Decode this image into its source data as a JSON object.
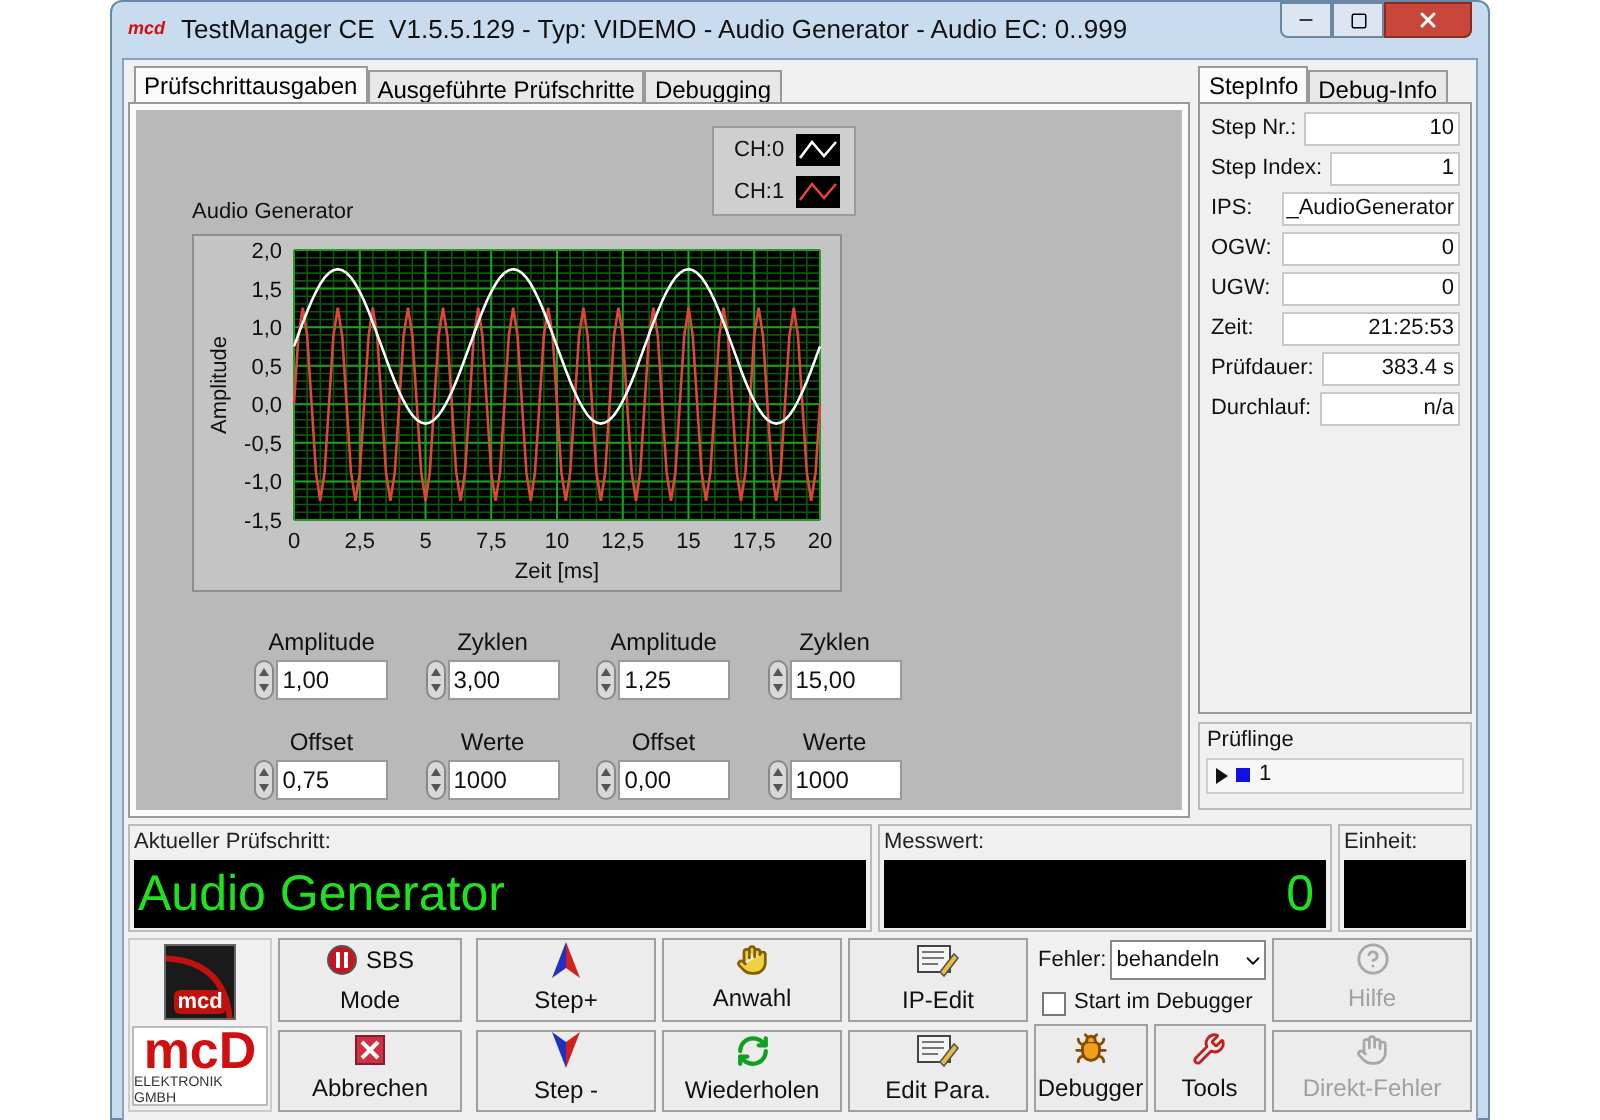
{
  "window": {
    "title": "TestManager CE  V1.5.5.129 - Typ: VIDEMO - Audio Generator - Audio EC: 0..999",
    "icon_text": "mcd"
  },
  "tabs": [
    {
      "label": "Prüfschrittausgaben",
      "selected": true
    },
    {
      "label": "Ausgeführte Prüfschritte",
      "selected": false
    },
    {
      "label": "Debugging",
      "selected": false
    }
  ],
  "graph": {
    "chart_data": {
      "type": "line",
      "grid": true,
      "title": "Audio Generator",
      "xlabel": "Zeit [ms]",
      "ylabel": "Amplitude",
      "xlim": [
        0,
        20
      ],
      "ylim": [
        -1.5,
        2
      ],
      "xticks": [
        0,
        {
          "value": 2.5,
          "label": "2,5"
        },
        5,
        {
          "value": 7.5,
          "label": "7,5"
        },
        10,
        {
          "value": 12.5,
          "label": "12,5"
        },
        15,
        {
          "value": 17.5,
          "label": "17,5"
        },
        20
      ],
      "yticks": [
        {
          "value": 2,
          "label": "2,0"
        },
        {
          "value": 1.5,
          "label": "1,5"
        },
        {
          "value": 1,
          "label": "1,0"
        },
        {
          "value": 0.5,
          "label": "0,5"
        },
        {
          "value": 0,
          "label": "0,0"
        },
        {
          "value": -0.5,
          "label": "-0,5"
        },
        {
          "value": -1,
          "label": "-1,0"
        },
        {
          "value": -1.5,
          "label": "-1,5"
        }
      ],
      "x": [
        0,
        0.167,
        0.333,
        0.5,
        0.667,
        0.833,
        1,
        1.167,
        1.333,
        1.5,
        1.667,
        1.833,
        2,
        2.167,
        2.333,
        2.5,
        2.667,
        2.833,
        3,
        3.167,
        3.333,
        3.5,
        3.667,
        3.833,
        4,
        4.167,
        4.333,
        4.5,
        4.667,
        4.833,
        5,
        5.167,
        5.333,
        5.5,
        5.667,
        5.833,
        6,
        6.167,
        6.333,
        6.5,
        6.667,
        6.833,
        7,
        7.167,
        7.333,
        7.5,
        7.667,
        7.833,
        8,
        8.167,
        8.333,
        8.5,
        8.667,
        8.833,
        9,
        9.167,
        9.333,
        9.5,
        9.667,
        9.833,
        10,
        10.167,
        10.333,
        10.5,
        10.667,
        10.833,
        11,
        11.167,
        11.333,
        11.5,
        11.667,
        11.833,
        12,
        12.167,
        12.333,
        12.5,
        12.667,
        12.833,
        13,
        13.167,
        13.333,
        13.5,
        13.667,
        13.833,
        14,
        14.167,
        14.333,
        14.5,
        14.667,
        14.833,
        15,
        15.167,
        15.333,
        15.5,
        15.667,
        15.833,
        16,
        16.167,
        16.333,
        16.5,
        16.667,
        16.833,
        17,
        17.167,
        17.333,
        17.5,
        17.667,
        17.833,
        18,
        18.167,
        18.333,
        18.5,
        18.667,
        18.833,
        19,
        19.167,
        19.333,
        19.5,
        19.667,
        19.833,
        20
      ],
      "series": [
        {
          "name": "CH:0",
          "color": "#ffffff",
          "values": [
            0.75,
            0.906,
            1.059,
            1.204,
            1.338,
            1.457,
            1.559,
            1.641,
            1.701,
            1.738,
            1.75,
            1.738,
            1.701,
            1.641,
            1.559,
            1.457,
            1.338,
            1.204,
            1.059,
            0.906,
            0.75,
            0.594,
            0.441,
            0.296,
            0.162,
            0.043,
            -0.059,
            -0.141,
            -0.201,
            -0.238,
            -0.25,
            -0.238,
            -0.201,
            -0.141,
            -0.059,
            0.043,
            0.162,
            0.296,
            0.441,
            0.594,
            0.75,
            0.906,
            1.059,
            1.204,
            1.338,
            1.457,
            1.559,
            1.641,
            1.701,
            1.738,
            1.75,
            1.738,
            1.701,
            1.641,
            1.559,
            1.457,
            1.338,
            1.204,
            1.059,
            0.906,
            0.75,
            0.594,
            0.441,
            0.296,
            0.162,
            0.043,
            -0.059,
            -0.141,
            -0.201,
            -0.238,
            -0.25,
            -0.238,
            -0.201,
            -0.141,
            -0.059,
            0.043,
            0.162,
            0.296,
            0.441,
            0.594,
            0.75,
            0.906,
            1.059,
            1.204,
            1.338,
            1.457,
            1.559,
            1.641,
            1.701,
            1.738,
            1.75,
            1.738,
            1.701,
            1.641,
            1.559,
            1.457,
            1.338,
            1.204,
            1.059,
            0.906,
            0.75,
            0.594,
            0.441,
            0.296,
            0.162,
            0.043,
            -0.059,
            -0.141,
            -0.201,
            -0.238,
            -0.25,
            -0.238,
            -0.201,
            -0.141,
            -0.059,
            0.043,
            0.162,
            0.296,
            0.441,
            0.594,
            0.75
          ]
        },
        {
          "name": "CH:1",
          "color": "#e0453a",
          "values": [
            0,
            0.884,
            1.25,
            0.884,
            0,
            -0.884,
            -1.25,
            -0.884,
            0,
            0.884,
            1.25,
            0.884,
            0,
            -0.884,
            -1.25,
            -0.884,
            0,
            0.884,
            1.25,
            0.884,
            0,
            -0.884,
            -1.25,
            -0.884,
            0,
            0.884,
            1.25,
            0.884,
            0,
            -0.884,
            -1.25,
            -0.884,
            0,
            0.884,
            1.25,
            0.884,
            0,
            -0.884,
            -1.25,
            -0.884,
            0,
            0.884,
            1.25,
            0.884,
            0,
            -0.884,
            -1.25,
            -0.884,
            0,
            0.884,
            1.25,
            0.884,
            0,
            -0.884,
            -1.25,
            -0.884,
            0,
            0.884,
            1.25,
            0.884,
            0,
            -0.884,
            -1.25,
            -0.884,
            0,
            0.884,
            1.25,
            0.884,
            0,
            -0.884,
            -1.25,
            -0.884,
            0,
            0.884,
            1.25,
            0.884,
            0,
            -0.884,
            -1.25,
            -0.884,
            0,
            0.884,
            1.25,
            0.884,
            0,
            -0.884,
            -1.25,
            -0.884,
            0,
            0.884,
            1.25,
            0.884,
            0,
            -0.884,
            -1.25,
            -0.884,
            0,
            0.884,
            1.25,
            0.884,
            0,
            -0.884,
            -1.25,
            -0.884,
            0,
            0.884,
            1.25,
            0.884,
            0,
            -0.884,
            -1.25,
            -0.884,
            0,
            0.884,
            1.25,
            0.884,
            0,
            -0.884,
            -1.25,
            -0.884,
            0
          ]
        }
      ]
    }
  },
  "controls": [
    {
      "label": "Amplitude",
      "value": "1,00"
    },
    {
      "label": "Zyklen",
      "value": "3,00"
    },
    {
      "label": "Amplitude",
      "value": "1,25"
    },
    {
      "label": "Zyklen",
      "value": "15,00"
    },
    {
      "label": "Offset",
      "value": "0,75"
    },
    {
      "label": "Werte",
      "value": "1000"
    },
    {
      "label": "Offset",
      "value": "0,00"
    },
    {
      "label": "Werte",
      "value": "1000"
    }
  ],
  "info_tabs": [
    {
      "label": "StepInfo",
      "selected": true
    },
    {
      "label": "Debug-Info",
      "selected": false
    }
  ],
  "step_info": [
    {
      "label": "Step Nr.:",
      "value": "10"
    },
    {
      "label": "Step Index:",
      "value": "1"
    },
    {
      "label": "IPS:",
      "value": "_AudioGenerator"
    },
    {
      "label": "OGW:",
      "value": "0"
    },
    {
      "label": "UGW:",
      "value": "0"
    },
    {
      "label": "Zeit:",
      "value": "21:25:53"
    },
    {
      "label": "Prüfdauer:",
      "value": "383.4 s"
    },
    {
      "label": "Durchlauf:",
      "value": "n/a"
    }
  ],
  "pruflinge": {
    "title": "Prüflinge",
    "items": [
      {
        "label": "1",
        "color": "#1010e0"
      }
    ]
  },
  "status": {
    "step_label": "Aktueller Prüfschritt:",
    "step_value": "Audio Generator",
    "measure_label": "Messwert:",
    "measure_value": "0",
    "unit_label": "Einheit:"
  },
  "logo": {
    "badge_text": "mcd",
    "wordmark": "mcD",
    "tagline": "ELEKTRONIK GMBH"
  },
  "toolbar": {
    "columns": [
      [
        {
          "kind": "sbs",
          "label": "SBS",
          "sublabel": "Mode",
          "disabled": false
        },
        {
          "kind": "abort",
          "label": "Abbrechen",
          "disabled": false
        }
      ],
      [
        {
          "kind": "step-up",
          "label": "Step+",
          "disabled": false
        },
        {
          "kind": "step-down",
          "label": "Step -",
          "disabled": false
        }
      ],
      [
        {
          "kind": "select",
          "label": "Anwahl",
          "disabled": false
        },
        {
          "kind": "repeat",
          "label": "Wiederholen",
          "disabled": false
        }
      ],
      [
        {
          "kind": "ip-edit",
          "label": "IP-Edit",
          "disabled": false
        },
        {
          "kind": "edit-params",
          "label": "Edit Para.",
          "disabled": false
        }
      ]
    ],
    "error_select": {
      "label": "Fehler:",
      "value": "behandeln"
    },
    "debugger_start": {
      "label": "Start im Debugger",
      "checked": false
    },
    "debug_buttons": [
      {
        "kind": "debugger",
        "label": "Debugger",
        "disabled": false
      },
      {
        "kind": "tools",
        "label": "Tools",
        "disabled": false
      }
    ],
    "help_buttons": [
      {
        "kind": "help",
        "label": "Hilfe",
        "disabled": true
      },
      {
        "kind": "direct-error",
        "label": "Direkt-Fehler",
        "disabled": true
      }
    ]
  }
}
